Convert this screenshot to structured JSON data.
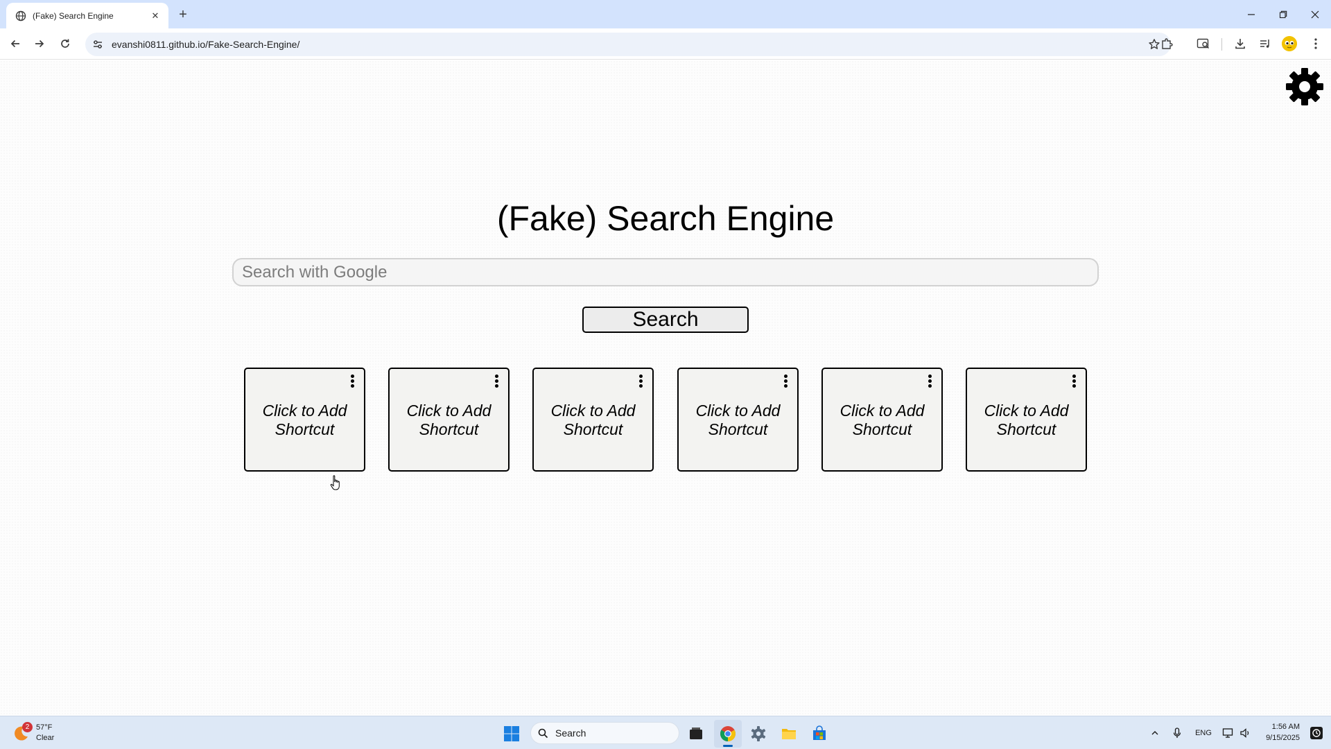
{
  "browser": {
    "tab": {
      "title": "(Fake) Search Engine",
      "close_glyph": "✕"
    },
    "new_tab_glyph": "+",
    "url": "evanshi0811.github.io/Fake-Search-Engine/",
    "window_controls": {
      "minimize": "─",
      "restore": "❐",
      "close": "✕"
    }
  },
  "page": {
    "title": "(Fake) Search Engine",
    "search": {
      "placeholder": "Search with Google",
      "value": ""
    },
    "search_button_label": "Search",
    "shortcuts": [
      {
        "line1": "Click to Add",
        "line2": "Shortcut"
      },
      {
        "line1": "Click to Add",
        "line2": "Shortcut"
      },
      {
        "line1": "Click to Add",
        "line2": "Shortcut"
      },
      {
        "line1": "Click to Add",
        "line2": "Shortcut"
      },
      {
        "line1": "Click to Add",
        "line2": "Shortcut"
      },
      {
        "line1": "Click to Add",
        "line2": "Shortcut"
      }
    ]
  },
  "taskbar": {
    "weather": {
      "temp": "57°F",
      "condition": "Clear",
      "badge": "2"
    },
    "search_label": "Search",
    "language": "ENG",
    "time": "1:56 AM",
    "date": "9/15/2025"
  },
  "colors": {
    "tabbar": "#d3e3fd",
    "omnibox": "#edf2fa",
    "taskbar": "#dde8f6",
    "accent": "#005fb8"
  }
}
